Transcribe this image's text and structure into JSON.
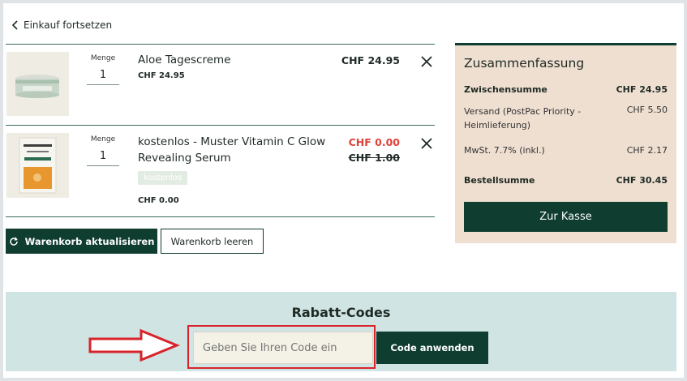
{
  "nav": {
    "back_label": "Einkauf fortsetzen"
  },
  "cart": {
    "items": [
      {
        "qty_label": "Menge",
        "qty": "1",
        "name": "Aloe Tagescreme",
        "unit_price": "CHF 24.95",
        "price": "CHF 24.95"
      },
      {
        "qty_label": "Menge",
        "qty": "1",
        "name_line1": "kostenlos - Muster Vitamin C Glow",
        "name_line2": "Revealing Serum",
        "badge": "kostenlos",
        "unit_price": "CHF 0.00",
        "price": "CHF 0.00",
        "old_price": "CHF 1.00"
      }
    ],
    "update_label": "Warenkorb aktualisieren",
    "clear_label": "Warenkorb leeren"
  },
  "summary": {
    "title": "Zusammenfassung",
    "subtotal_label": "Zwischensumme",
    "subtotal_value": "CHF 24.95",
    "shipping_label_1": "Versand (PostPac Priority -",
    "shipping_label_2": "Heimlieferung)",
    "shipping_value": "CHF 5.50",
    "vat_label": "MwSt. 7.7% (inkl.)",
    "vat_value": "CHF 2.17",
    "total_label": "Bestellsumme",
    "total_value": "CHF 30.45",
    "checkout_label": "Zur Kasse"
  },
  "discount": {
    "title": "Rabatt-Codes",
    "placeholder": "Geben Sie Ihren Code ein",
    "apply_label": "Code anwenden"
  },
  "colors": {
    "primary": "#0f3d30",
    "sale_red": "#e0413a",
    "summary_bg": "#eedfd1",
    "discount_bg": "#cfe4e3",
    "annotation_red": "#d8232a"
  }
}
